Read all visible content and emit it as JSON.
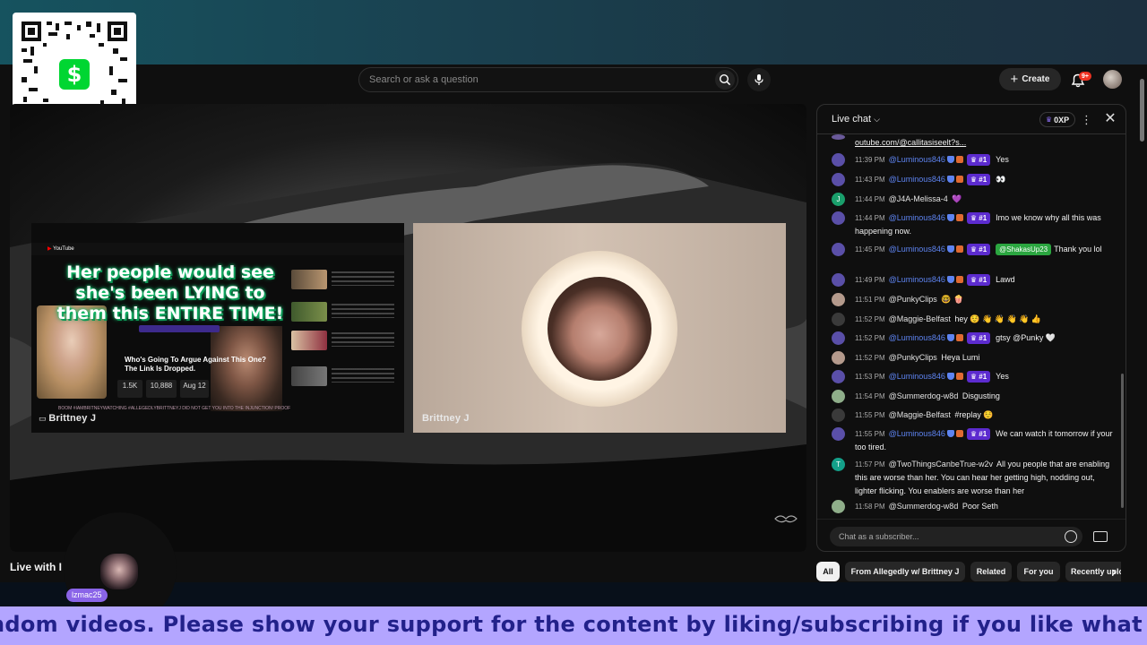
{
  "header": {
    "search_placeholder": "Search or ask a question",
    "create_label": "Create",
    "notif_count": "9+"
  },
  "video": {
    "left_panel": {
      "headline": "Her people would see she's been LYING to them this ENTIRE TIME!",
      "question": "Who's Going To Argue Against This One? The Link Is Dropped.",
      "stats": [
        "1.5K",
        "10,888",
        "Aug 12"
      ],
      "ticker": "BOOM #IAMBRITNEYWATCHING #ALLEGEDLYBRITTNEYJ DID NOT GET YOU INTO THE INJUNCTION! PROOF",
      "name": "Brittney J"
    },
    "right_panel": {
      "name": "Brittney J"
    }
  },
  "chat": {
    "title": "Live chat",
    "points": "0XP",
    "input_placeholder": "Chat as a subscriber...",
    "pinned_link": "outube.com/@callitasiseelt?s...",
    "messages": [
      {
        "time": "11:39 PM",
        "author": "@Luminous846",
        "mod": true,
        "rank": "#1",
        "text": "Yes"
      },
      {
        "time": "11:43 PM",
        "author": "@Luminous846",
        "mod": true,
        "rank": "#1",
        "text": "👀"
      },
      {
        "time": "11:44 PM",
        "author": "@J4A-Melissa-4",
        "mod": false,
        "text": "💜"
      },
      {
        "time": "11:44 PM",
        "author": "@Luminous846",
        "mod": true,
        "rank": "#1",
        "text": "Imo we know why all this was happening now."
      },
      {
        "time": "11:45 PM",
        "author": "@Luminous846",
        "mod": true,
        "rank": "#1",
        "mention": "@ShakasUp23",
        "text": "Thank you lol"
      },
      {
        "time": "11:49 PM",
        "author": "@Luminous846",
        "mod": true,
        "rank": "#1",
        "text": "Lawd"
      },
      {
        "time": "11:51 PM",
        "author": "@PunkyClips",
        "mod": false,
        "text": "🤓 🍿"
      },
      {
        "time": "11:52 PM",
        "author": "@Maggie-Belfast",
        "mod": false,
        "text": "hey ☺️ 👋 👋 👋 👋 👍"
      },
      {
        "time": "11:52 PM",
        "author": "@Luminous846",
        "mod": true,
        "rank": "#1",
        "text": "gtsy @Punky 🤍"
      },
      {
        "time": "11:52 PM",
        "author": "@PunkyClips",
        "mod": false,
        "text": "Heya Lumi"
      },
      {
        "time": "11:53 PM",
        "author": "@Luminous846",
        "mod": true,
        "rank": "#1",
        "text": "Yes"
      },
      {
        "time": "11:54 PM",
        "author": "@Summerdog-w8d",
        "mod": false,
        "text": "Disgusting"
      },
      {
        "time": "11:55 PM",
        "author": "@Maggie-Belfast",
        "mod": false,
        "text": "#replay ☺️"
      },
      {
        "time": "11:55 PM",
        "author": "@Luminous846",
        "mod": true,
        "rank": "#1",
        "text": "We can watch it tomorrow if your too tired."
      },
      {
        "time": "11:57 PM",
        "author": "@TwoThingsCanbeTrue-w2v",
        "mod": false,
        "text": "All you people that are enabling this are worse than her. You can hear her getting high, nodding out, lighter flicking. You enablers are worse than her"
      },
      {
        "time": "11:58 PM",
        "author": "@Summerdog-w8d",
        "mod": false,
        "text": "Poor Seth"
      }
    ]
  },
  "chips": [
    "All",
    "From Allegedly w/ Brittney J",
    "Related",
    "For you",
    "Recently uploaded"
  ],
  "title": "Live with I",
  "overlay_user": "lzmac25",
  "ticker_text": "ndom videos. Please show your support for the content by liking/subscribing if you like what you see. As a re",
  "colors": {
    "accent": "#5c2bcf",
    "mod_name": "#5e84f1",
    "ticker_bg": "#b3a5ff",
    "ticker_text": "#22218a"
  }
}
